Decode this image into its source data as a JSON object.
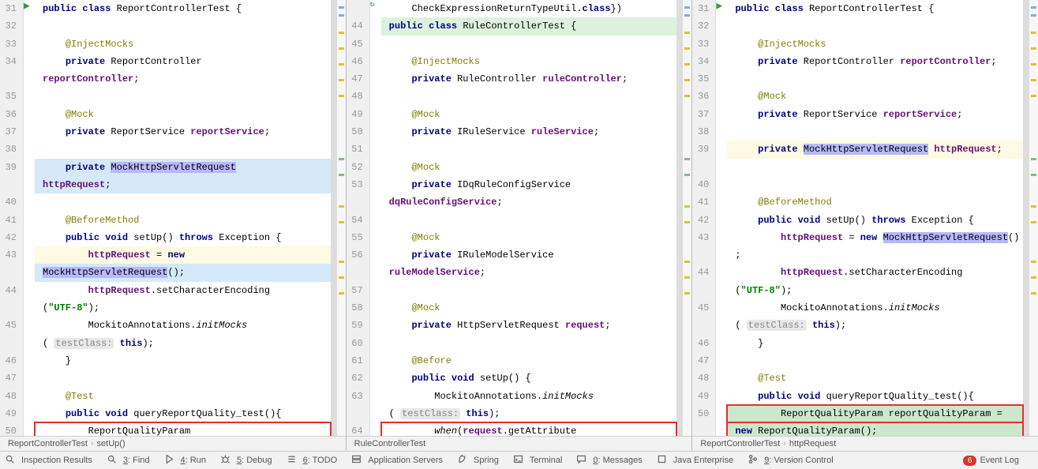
{
  "panes": [
    {
      "lines": [
        {
          "n": 31,
          "cls": "",
          "html": "<span class='kw'>public</span> <span class='kw'>class</span> <span class='cls'>ReportControllerTest</span> {"
        },
        {
          "n": 32,
          "cls": "",
          "html": ""
        },
        {
          "n": 33,
          "cls": "",
          "html": "    <span class='ann'>@InjectMocks</span>"
        },
        {
          "n": 34,
          "cls": "",
          "html": "    <span class='kw'>private</span> ReportController"
        },
        {
          "n": "",
          "cls": "",
          "html": "<span class='field'>reportController</span>;"
        },
        {
          "n": 35,
          "cls": "",
          "html": ""
        },
        {
          "n": 36,
          "cls": "",
          "html": "    <span class='ann'>@Mock</span>"
        },
        {
          "n": 37,
          "cls": "",
          "html": "    <span class='kw'>private</span> ReportService <span class='field'>reportService</span>;"
        },
        {
          "n": 38,
          "cls": "",
          "html": ""
        },
        {
          "n": 39,
          "cls": "diff-mod",
          "html": "    <span class='kw'>private</span> <span class='hl'>MockHttpServletRequest</span>"
        },
        {
          "n": "",
          "cls": "diff-mod",
          "html": "<span class='field'>httpRequest</span>;"
        },
        {
          "n": 40,
          "cls": "",
          "html": ""
        },
        {
          "n": 41,
          "cls": "",
          "html": "    <span class='ann'>@BeforeMethod</span>"
        },
        {
          "n": 42,
          "cls": "",
          "html": "    <span class='kw'>public</span> <span class='kw'>void</span> setUp() <span class='kw'>throws</span> <span class='cls'>Exception</span> {"
        },
        {
          "n": 43,
          "cls": "current",
          "html": "        <span class='field'>httpRequest</span> = <span class='kw'>new</span>"
        },
        {
          "n": "",
          "cls": "diff-mod",
          "html": "<span class='hl'>MockHttpServletRequest</span>();"
        },
        {
          "n": 44,
          "cls": "",
          "html": "        <span class='field'>httpRequest</span>.setCharacterEncoding"
        },
        {
          "n": "",
          "cls": "",
          "html": "(<span class='str'>\"UTF-8\"</span>);"
        },
        {
          "n": 45,
          "cls": "",
          "html": "        MockitoAnnotations.<span style='font-style:italic'>initMocks</span>"
        },
        {
          "n": "",
          "cls": "",
          "html": "( <span class='hint'>testClass:</span> <span class='kw'>this</span>);"
        },
        {
          "n": 46,
          "cls": "",
          "html": "    }"
        },
        {
          "n": 47,
          "cls": "",
          "html": ""
        },
        {
          "n": 48,
          "cls": "",
          "html": "    <span class='ann'>@Test</span>"
        },
        {
          "n": 49,
          "cls": "",
          "html": "    <span class='kw'>public</span> <span class='kw'>void</span> queryReportQuality_test(){",
          "run": true
        },
        {
          "n": 50,
          "cls": "red-box",
          "html": "        ReportQualityParam"
        }
      ],
      "crumbs": [
        "ReportControllerTest",
        "setUp()"
      ]
    },
    {
      "lines": [
        {
          "n": "",
          "cls": "",
          "html": "    CheckExpressionReturnTypeUtil.<span class='kw'>class</span>})"
        },
        {
          "n": 44,
          "cls": "diff-add",
          "html": "<span class='kw'>public</span> <span class='kw'>class</span> <span class='cls'>RuleControllerTest</span> {",
          "diffIcon": "↻"
        },
        {
          "n": 45,
          "cls": "",
          "html": ""
        },
        {
          "n": 46,
          "cls": "",
          "html": "    <span class='ann'>@InjectMocks</span>"
        },
        {
          "n": 47,
          "cls": "",
          "html": "    <span class='kw'>private</span> RuleController <span class='field'>ruleController</span>;"
        },
        {
          "n": 48,
          "cls": "",
          "html": ""
        },
        {
          "n": 49,
          "cls": "",
          "html": "    <span class='ann'>@Mock</span>"
        },
        {
          "n": 50,
          "cls": "",
          "html": "    <span class='kw'>private</span> IRuleService <span class='field'>ruleService</span>;"
        },
        {
          "n": 51,
          "cls": "",
          "html": ""
        },
        {
          "n": 52,
          "cls": "",
          "html": "    <span class='ann'>@Mock</span>"
        },
        {
          "n": 53,
          "cls": "",
          "html": "    <span class='kw'>private</span> IDqRuleConfigService"
        },
        {
          "n": "",
          "cls": "",
          "html": "<span class='field'>dqRuleConfigService</span>;"
        },
        {
          "n": 54,
          "cls": "",
          "html": ""
        },
        {
          "n": 55,
          "cls": "",
          "html": "    <span class='ann'>@Mock</span>"
        },
        {
          "n": 56,
          "cls": "",
          "html": "    <span class='kw'>private</span> IRuleModelService"
        },
        {
          "n": "",
          "cls": "",
          "html": "<span class='field'>ruleModelService</span>;"
        },
        {
          "n": 57,
          "cls": "",
          "html": ""
        },
        {
          "n": 58,
          "cls": "",
          "html": "    <span class='ann'>@Mock</span>"
        },
        {
          "n": 59,
          "cls": "",
          "html": "    <span class='kw'>private</span> HttpServletRequest <span class='field'>request</span>;"
        },
        {
          "n": 60,
          "cls": "",
          "html": ""
        },
        {
          "n": 61,
          "cls": "",
          "html": "    <span class='ann'>@Before</span>"
        },
        {
          "n": 62,
          "cls": "",
          "html": "    <span class='kw'>public</span> <span class='kw'>void</span> setUp() {"
        },
        {
          "n": 63,
          "cls": "",
          "html": "        MockitoAnnotations.<span style='font-style:italic'>initMocks</span>"
        },
        {
          "n": "",
          "cls": "",
          "html": "( <span class='hint'>testClass:</span> <span class='kw'>this</span>);"
        },
        {
          "n": 64,
          "cls": "red-box",
          "html": "        <span style='font-style:italic'>when</span>(<span class='field'>request</span>.getAttribute"
        }
      ],
      "crumbs": [
        "RuleControllerTest"
      ]
    },
    {
      "lines": [
        {
          "n": 31,
          "cls": "",
          "html": "<span class='kw'>public</span> <span class='kw'>class</span> <span class='cls'>ReportControllerTest</span> {"
        },
        {
          "n": 32,
          "cls": "",
          "html": ""
        },
        {
          "n": 33,
          "cls": "",
          "html": "    <span class='ann'>@InjectMocks</span>"
        },
        {
          "n": 34,
          "cls": "",
          "html": "    <span class='kw'>private</span> ReportController <span class='field'>reportController</span>;"
        },
        {
          "n": 35,
          "cls": "",
          "html": ""
        },
        {
          "n": 36,
          "cls": "",
          "html": "    <span class='ann'>@Mock</span>"
        },
        {
          "n": 37,
          "cls": "",
          "html": "    <span class='kw'>private</span> ReportService <span class='field'>reportService</span>;"
        },
        {
          "n": 38,
          "cls": "",
          "html": ""
        },
        {
          "n": 39,
          "cls": "current",
          "html": "    <span class='kw'>private</span> <span class='hl'>MockHttpServletRequest</span> <span class='field'>httpRequest</span>;"
        },
        {
          "n": "",
          "cls": "",
          "html": ""
        },
        {
          "n": 40,
          "cls": "",
          "html": ""
        },
        {
          "n": 41,
          "cls": "",
          "html": "    <span class='ann'>@BeforeMethod</span>"
        },
        {
          "n": 42,
          "cls": "",
          "html": "    <span class='kw'>public</span> <span class='kw'>void</span> setUp() <span class='kw'>throws</span> <span class='cls'>Exception</span> {"
        },
        {
          "n": 43,
          "cls": "",
          "html": "        <span class='field'>httpRequest</span> = <span class='kw'>new</span> <span class='hl'>MockHttpServletRequest</span>()"
        },
        {
          "n": "",
          "cls": "",
          "html": ";"
        },
        {
          "n": 44,
          "cls": "",
          "html": "        <span class='field'>httpRequest</span>.setCharacterEncoding"
        },
        {
          "n": "",
          "cls": "",
          "html": "(<span class='str'>\"UTF-8\"</span>);"
        },
        {
          "n": 45,
          "cls": "",
          "html": "        MockitoAnnotations.<span style='font-style:italic'>initMocks</span>"
        },
        {
          "n": "",
          "cls": "",
          "html": "( <span class='hint'>testClass:</span> <span class='kw'>this</span>);"
        },
        {
          "n": 46,
          "cls": "",
          "html": "    }"
        },
        {
          "n": 47,
          "cls": "",
          "html": ""
        },
        {
          "n": 48,
          "cls": "",
          "html": "    <span class='ann'>@Test</span>"
        },
        {
          "n": 49,
          "cls": "",
          "html": "    <span class='kw'>public</span> <span class='kw'>void</span> queryReportQuality_test(){",
          "run": true
        },
        {
          "n": 50,
          "cls": "red-box-green",
          "html": "        ReportQualityParam reportQualityParam ="
        },
        {
          "n": "",
          "cls": "red-box-green",
          "html": "<span class='kw'>new</span> ReportQualityParam();"
        }
      ],
      "crumbs": [
        "ReportControllerTest",
        "httpRequest"
      ]
    }
  ],
  "toolbar": [
    {
      "icon": "lens",
      "label": "Inspection Results",
      "u": ""
    },
    {
      "icon": "search",
      "label": "Find",
      "u": "3",
      "prefix": "3: "
    },
    {
      "icon": "play",
      "label": "Run",
      "u": "4",
      "prefix": "4: "
    },
    {
      "icon": "bug",
      "label": "Debug",
      "u": "5",
      "prefix": "5: "
    },
    {
      "icon": "list",
      "label": "TODO",
      "u": "6",
      "prefix": "6: "
    },
    {
      "icon": "server",
      "label": "Application Servers",
      "u": ""
    },
    {
      "icon": "leaf",
      "label": "Spring",
      "u": ""
    },
    {
      "icon": "term",
      "label": "Terminal",
      "u": ""
    },
    {
      "icon": "msg",
      "label": "Messages",
      "u": "0",
      "prefix": "0: "
    },
    {
      "icon": "ent",
      "label": "Java Enterprise",
      "u": ""
    },
    {
      "icon": "vcs",
      "label": "Version Control",
      "u": "9",
      "prefix": "9: "
    }
  ],
  "eventlog": {
    "count": "6",
    "label": "Event Log"
  }
}
